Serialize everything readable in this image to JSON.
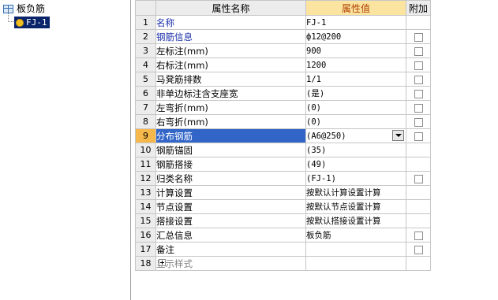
{
  "tree": {
    "root_label": "板负筋",
    "child_label": "FJ-1"
  },
  "grid": {
    "headers": {
      "index": "",
      "name": "属性名称",
      "value": "属性值",
      "extra": "附加"
    },
    "rows": [
      {
        "index": "1",
        "name": "名称",
        "value": "FJ-1",
        "checkbox": false
      },
      {
        "index": "2",
        "name": "钢筋信息",
        "value": "ф12@200",
        "checkbox": true
      },
      {
        "index": "3",
        "name": "左标注(mm)",
        "value": "900",
        "checkbox": true
      },
      {
        "index": "4",
        "name": "右标注(mm)",
        "value": "1200",
        "checkbox": true
      },
      {
        "index": "5",
        "name": "马凳筋排数",
        "value": "1/1",
        "checkbox": true
      },
      {
        "index": "6",
        "name": "非单边标注含支座宽",
        "value": "(是)",
        "checkbox": true
      },
      {
        "index": "7",
        "name": "左弯折(mm)",
        "value": "(0)",
        "checkbox": true
      },
      {
        "index": "8",
        "name": "右弯折(mm)",
        "value": "(0)",
        "checkbox": true
      },
      {
        "index": "9",
        "name": "分布钢筋",
        "value": "(A6@250)",
        "checkbox": true
      },
      {
        "index": "10",
        "name": "钢筋锚固",
        "value": "(35)",
        "checkbox": false
      },
      {
        "index": "11",
        "name": "钢筋搭接",
        "value": "(49)",
        "checkbox": false
      },
      {
        "index": "12",
        "name": "归类名称",
        "value": "(FJ-1)",
        "checkbox": true
      },
      {
        "index": "13",
        "name": "计算设置",
        "value": "按默认计算设置计算",
        "checkbox": false
      },
      {
        "index": "14",
        "name": "节点设置",
        "value": "按默认节点设置计算",
        "checkbox": false
      },
      {
        "index": "15",
        "name": "搭接设置",
        "value": "按默认搭接设置计算",
        "checkbox": false
      },
      {
        "index": "16",
        "name": "汇总信息",
        "value": "板负筋",
        "checkbox": true
      },
      {
        "index": "17",
        "name": "备注",
        "value": "",
        "checkbox": true
      },
      {
        "index": "18",
        "name": "显示样式",
        "value": "",
        "checkbox": false
      }
    ]
  },
  "colors": {
    "header_value_bg": "#fbe3a0",
    "header_value_text": "#b04000",
    "name_blue": "#1a2ea8",
    "selected_name_bg": "#3265c8",
    "selected_index_bg": "#f6b84a",
    "tree_selected_bg": "#0a246a"
  }
}
